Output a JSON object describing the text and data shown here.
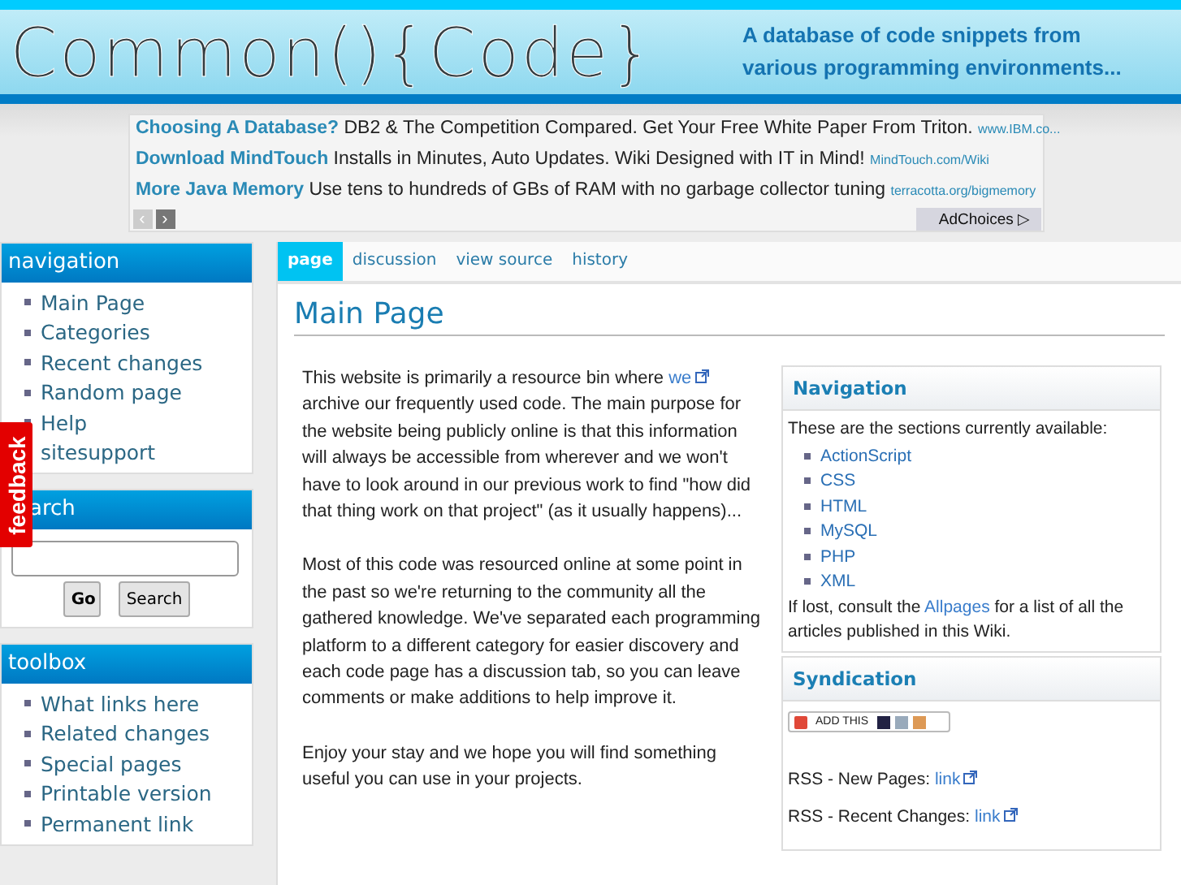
{
  "header": {
    "logo": "Common(){Code}",
    "tagline": "A database of code snippets from various programming environments..."
  },
  "ads": {
    "items": [
      {
        "title": "Choosing A Database?",
        "text": "DB2 & The Competition Compared. Get Your Free White Paper From Triton.",
        "url": "www.IBM.co..."
      },
      {
        "title": "Download MindTouch",
        "text": "Installs in Minutes, Auto Updates. Wiki Designed with IT in Mind!",
        "url": "MindTouch.com/Wiki"
      },
      {
        "title": "More Java Memory",
        "text": "Use tens to hundreds of GBs of RAM with no garbage collector tuning",
        "url": "terracotta.org/bigmemory"
      }
    ],
    "prev": "‹",
    "next": "›",
    "adchoices": "AdChoices ▷"
  },
  "sidebar": {
    "navigation": {
      "title": "navigation",
      "items": [
        "Main Page",
        "Categories",
        "Recent changes",
        "Random page",
        "Help",
        "sitesupport"
      ]
    },
    "search": {
      "title": "arch",
      "buttons": [
        "Go",
        "Search"
      ]
    },
    "toolbox": {
      "title": "toolbox",
      "items": [
        "What links here",
        "Related changes",
        "Special pages",
        "Printable version",
        "Permanent link"
      ]
    },
    "feedback": "feedback"
  },
  "tabs": [
    {
      "label": "page",
      "selected": true
    },
    {
      "label": "discussion",
      "selected": false
    },
    {
      "label": "view source",
      "selected": false
    },
    {
      "label": "history",
      "selected": false
    }
  ],
  "page_title": "Main Page",
  "intro": {
    "before": "This website is primarily a resource bin where",
    "link": "we",
    "after": "archive our frequently used code. The main purpose for the website being publicly online is that this information will always be accessible from wherever and we won't have to look around in our previous work to find \"how did that thing work on that project\" (as it usually happens)..."
  },
  "paragraphs": [
    "Most of this code was resourced online at some point in the past so we're returning to the community all the gathered knowledge. We've separated each programming platform to a different category for easier discovery and each code page has a discussion tab, so you can leave comments or make additions to help improve it.",
    "Enjoy your stay and we hope you will find something useful you can use in your projects."
  ],
  "nav_box": {
    "title": "Navigation",
    "intro": "These are the sections currently available:",
    "items": [
      "ActionScript",
      "CSS",
      "HTML",
      "MySQL",
      "PHP",
      "XML"
    ],
    "footer_before": "If lost, consult the",
    "footer_link": "Allpages",
    "footer_after": "for a list of all the articles published in this Wiki."
  },
  "syndication": {
    "title": "Syndication",
    "addthis": "ADD THIS",
    "feeds": [
      {
        "label": "RSS - New Pages:",
        "link": "link"
      },
      {
        "label": "RSS - Recent Changes:",
        "link": "link"
      }
    ]
  }
}
